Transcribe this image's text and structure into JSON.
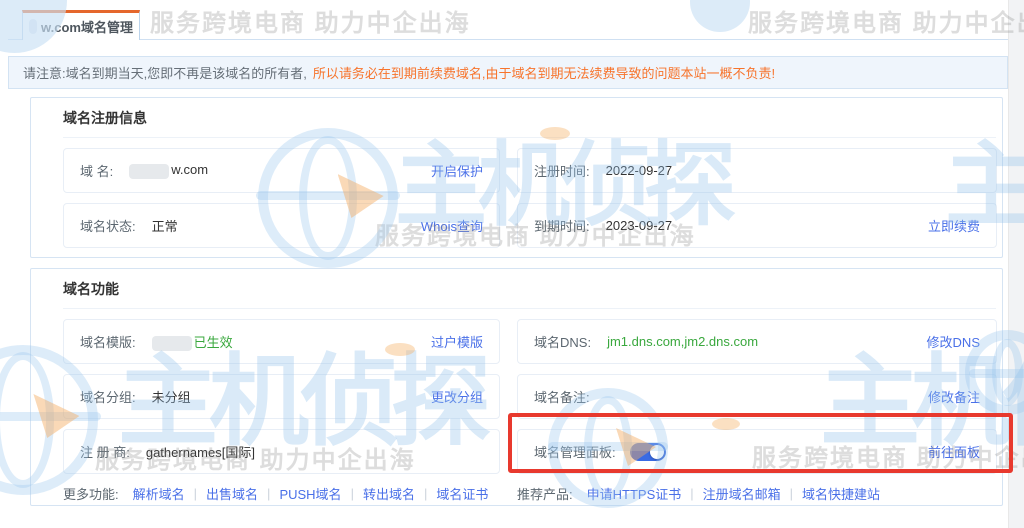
{
  "colors": {
    "accent_blue": "#4a70e8",
    "toggle_blue": "#3a6be4",
    "green": "#3aa83e",
    "notice_orange": "#f7742c",
    "tab_orange": "#e5672c",
    "highlight_red": "#e8392e"
  },
  "watermark": {
    "brand": "主机侦探",
    "tagline": "服务跨境电商 助力中企出海"
  },
  "tab": {
    "label": "w.com域名管理"
  },
  "notice": {
    "normal": "请注意:域名到期当天,您即不再是该域名的所有者,",
    "highlight": "所以请务必在到期前续费域名,由于域名到期无法续费导致的问题本站一概不负责!"
  },
  "reg": {
    "title": "域名注册信息",
    "domain_label": "域 名:",
    "domain_value": "w.com",
    "protect_link": "开启保护",
    "regtime_label": "注册时间:",
    "regtime_value": "2022-09-27",
    "status_label": "域名状态:",
    "status_value": "正常",
    "whois_link": "Whois查询",
    "expire_label": "到期时间:",
    "expire_value": "2023-09-27",
    "renew_link": "立即续费"
  },
  "func": {
    "title": "域名功能",
    "template_label": "域名模版:",
    "template_value": "已生效",
    "template_link": "过户模版",
    "dns_label": "域名DNS:",
    "dns_value": "jm1.dns.com,jm2.dns.com",
    "dns_link": "修改DNS",
    "group_label": "域名分组:",
    "group_value": "未分组",
    "group_link": "更改分组",
    "remark_label": "域名备注:",
    "remark_value": "",
    "remark_link": "修改备注",
    "registrar_label": "注 册 商:",
    "registrar_value": "gathernames[国际]",
    "panel_label": "域名管理面板:",
    "panel_toggle_on": true,
    "panel_link": "前往面板"
  },
  "footer": {
    "more_label": "更多功能:",
    "more_links": [
      "解析域名",
      "出售域名",
      "PUSH域名",
      "转出域名",
      "域名证书"
    ],
    "rec_label": "推荐产品:",
    "rec_links": [
      "申请HTTPS证书",
      "注册域名邮箱",
      "域名快捷建站"
    ]
  }
}
